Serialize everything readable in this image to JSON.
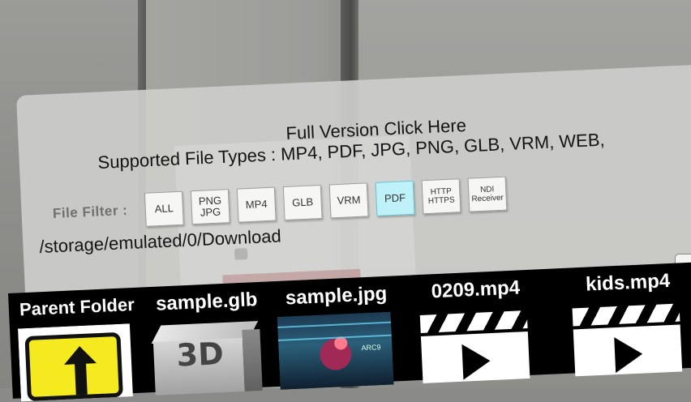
{
  "header": {
    "full_version": "Full Version Click Here",
    "supported_types": "Supported File Types : MP4, PDF, JPG, PNG, GLB, VRM, WEB,"
  },
  "filter": {
    "label": "File Filter :",
    "buttons": [
      {
        "line1": "ALL",
        "line2": ""
      },
      {
        "line1": "PNG",
        "line2": "JPG"
      },
      {
        "line1": "MP4",
        "line2": ""
      },
      {
        "line1": "GLB",
        "line2": ""
      },
      {
        "line1": "VRM",
        "line2": ""
      },
      {
        "line1": "PDF",
        "line2": ""
      },
      {
        "line1": "HTTP",
        "line2": "HTTPS"
      },
      {
        "line1": "NDI",
        "line2": "Receiver"
      }
    ],
    "active": "PDF",
    "active_color": "#bff1f8"
  },
  "path": "/storage/emulated/0/Download",
  "files": [
    {
      "name": "Parent Folder",
      "icon": "up-arrow-folder-icon"
    },
    {
      "name": "sample.glb",
      "icon": "3d-cube-icon",
      "icon_text": "3D"
    },
    {
      "name": "sample.jpg",
      "icon": "photo-thumbnail",
      "sign_text": "ARC9"
    },
    {
      "name": "0209.mp4",
      "icon": "clapperboard-icon"
    },
    {
      "name": "kids.mp4",
      "icon": "clapperboard-icon"
    }
  ]
}
